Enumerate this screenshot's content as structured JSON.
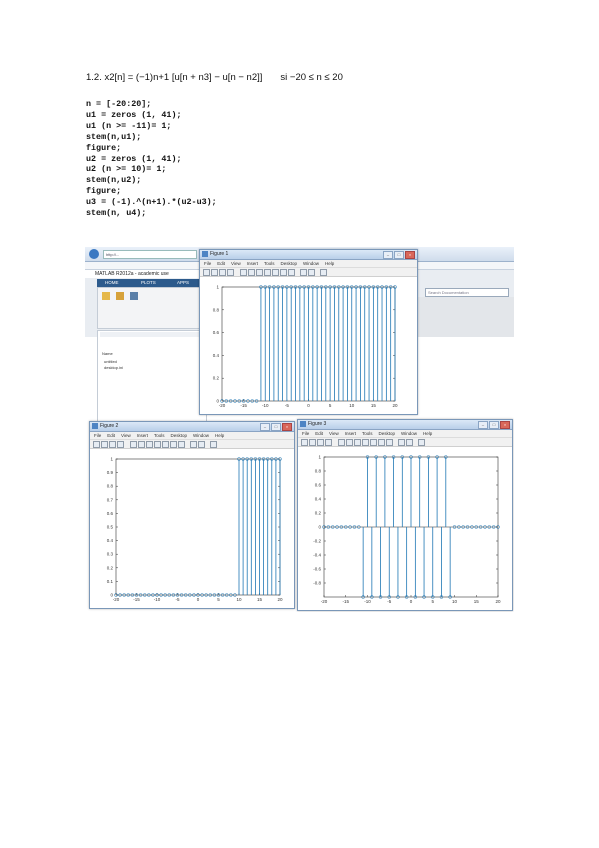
{
  "document": {
    "heading": "1.2.  x2[n] = (−1)n+1 [u[n + n3] − u[n − n2]]",
    "condition": "si   −20 ≤ n ≤ 20",
    "code_lines": [
      "n = [-20:20];",
      "u1 = zeros (1, 41);",
      "u1 (n >= -11)= 1;",
      "stem(n,u1);",
      "figure;",
      "u2 = zeros (1, 41);",
      "u2 (n >= 10)= 1;",
      "stem(n,u2);",
      "figure;",
      "u3 = (-1).^(n+1).*(u2-u3);",
      "stem(n, u4);"
    ]
  },
  "screenshot": {
    "matlab_window": {
      "title": "MATLAB R2012a - academic use",
      "address": "http://...",
      "tabs": [
        "HOME",
        "PLOTS",
        "APPS"
      ],
      "search_placeholder": "Search Documentation",
      "folder_items": [
        "Name",
        "untitled",
        "desktop.ini"
      ]
    },
    "menus": [
      "File",
      "Edit",
      "View",
      "Insert",
      "Tools",
      "Desktop",
      "Window",
      "Help"
    ],
    "colors": {
      "stem": "#1f77b4",
      "titlebar": "#b9cfe9"
    },
    "figures": [
      {
        "title": "Figure 1",
        "chart_data": {
          "type": "stem",
          "x": [
            -20,
            -19,
            -18,
            -17,
            -16,
            -15,
            -14,
            -13,
            -12,
            -11,
            -10,
            -9,
            -8,
            -7,
            -6,
            -5,
            -4,
            -3,
            -2,
            -1,
            0,
            1,
            2,
            3,
            4,
            5,
            6,
            7,
            8,
            9,
            10,
            11,
            12,
            13,
            14,
            15,
            16,
            17,
            18,
            19,
            20
          ],
          "y": [
            0,
            0,
            0,
            0,
            0,
            0,
            0,
            0,
            0,
            1,
            1,
            1,
            1,
            1,
            1,
            1,
            1,
            1,
            1,
            1,
            1,
            1,
            1,
            1,
            1,
            1,
            1,
            1,
            1,
            1,
            1,
            1,
            1,
            1,
            1,
            1,
            1,
            1,
            1,
            1,
            1
          ],
          "xticks": [
            "-20",
            "-15",
            "-10",
            "-5",
            "0",
            "5",
            "10",
            "15",
            "20"
          ],
          "yticks": [
            "0",
            "0.2",
            "0.4",
            "0.6",
            "0.8",
            "1"
          ],
          "xlim": [
            -20,
            20
          ],
          "ylim": [
            0,
            1
          ]
        }
      },
      {
        "title": "Figure 2",
        "chart_data": {
          "type": "stem",
          "x": [
            -20,
            -19,
            -18,
            -17,
            -16,
            -15,
            -14,
            -13,
            -12,
            -11,
            -10,
            -9,
            -8,
            -7,
            -6,
            -5,
            -4,
            -3,
            -2,
            -1,
            0,
            1,
            2,
            3,
            4,
            5,
            6,
            7,
            8,
            9,
            10,
            11,
            12,
            13,
            14,
            15,
            16,
            17,
            18,
            19,
            20
          ],
          "y": [
            0,
            0,
            0,
            0,
            0,
            0,
            0,
            0,
            0,
            0,
            0,
            0,
            0,
            0,
            0,
            0,
            0,
            0,
            0,
            0,
            0,
            0,
            0,
            0,
            0,
            0,
            0,
            0,
            0,
            0,
            1,
            1,
            1,
            1,
            1,
            1,
            1,
            1,
            1,
            1,
            1
          ],
          "xticks": [
            "-20",
            "-15",
            "-10",
            "-5",
            "0",
            "5",
            "10",
            "15",
            "20"
          ],
          "yticks": [
            "0",
            "0.1",
            "0.2",
            "0.3",
            "0.4",
            "0.5",
            "0.6",
            "0.7",
            "0.8",
            "0.9",
            "1"
          ],
          "xlim": [
            -20,
            20
          ],
          "ylim": [
            0,
            1
          ]
        }
      },
      {
        "title": "Figure 3",
        "chart_data": {
          "type": "stem",
          "x": [
            -20,
            -19,
            -18,
            -17,
            -16,
            -15,
            -14,
            -13,
            -12,
            -11,
            -10,
            -9,
            -8,
            -7,
            -6,
            -5,
            -4,
            -3,
            -2,
            -1,
            0,
            1,
            2,
            3,
            4,
            5,
            6,
            7,
            8,
            9,
            10,
            11,
            12,
            13,
            14,
            15,
            16,
            17,
            18,
            19,
            20
          ],
          "y": [
            0,
            0,
            0,
            0,
            0,
            0,
            0,
            0,
            0,
            -1,
            1,
            -1,
            1,
            -1,
            1,
            -1,
            1,
            -1,
            1,
            -1,
            1,
            -1,
            1,
            -1,
            1,
            -1,
            1,
            -1,
            1,
            -1,
            0,
            0,
            0,
            0,
            0,
            0,
            0,
            0,
            0,
            0,
            0
          ],
          "xticks": [
            "-20",
            "-15",
            "-10",
            "-5",
            "0",
            "5",
            "10",
            "15",
            "20"
          ],
          "yticks": [
            "-0.8",
            "-0.6",
            "-0.4",
            "-0.2",
            "0",
            "0.2",
            "0.4",
            "0.6",
            "0.8",
            "1"
          ],
          "xlim": [
            -20,
            20
          ],
          "ylim": [
            -1,
            1
          ]
        }
      }
    ]
  }
}
